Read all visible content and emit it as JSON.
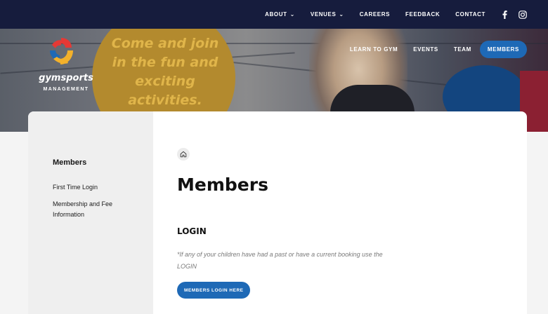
{
  "topnav": {
    "items": [
      {
        "label": "ABOUT",
        "has_dropdown": true
      },
      {
        "label": "VENUES",
        "has_dropdown": true
      },
      {
        "label": "CAREERS",
        "has_dropdown": false
      },
      {
        "label": "FEEDBACK",
        "has_dropdown": false
      },
      {
        "label": "CONTACT",
        "has_dropdown": false
      }
    ],
    "social": [
      "facebook-icon",
      "instagram-icon"
    ]
  },
  "logo": {
    "name": "gymsports",
    "sub": "MANAGEMENT"
  },
  "hero": {
    "slogan": "Come and join in the fun and exciting activities."
  },
  "mainnav": {
    "items": [
      {
        "label": "LEARN TO GYM"
      },
      {
        "label": "EVENTS"
      },
      {
        "label": "TEAM"
      },
      {
        "label": "MEMBERS",
        "active": true
      }
    ]
  },
  "sidebar": {
    "title": "Members",
    "links": [
      {
        "label": "First Time Login"
      },
      {
        "label": "Membership and Fee Information"
      }
    ]
  },
  "content": {
    "breadcrumb_icon": "home-icon",
    "title": "Members",
    "section_title": "LOGIN",
    "note": "*If any of your children have had a past or have a current booking use the LOGIN",
    "button_label": "MEMBERS LOGIN HERE"
  },
  "colors": {
    "topbar": "#161c3d",
    "accent_blue": "#1e69b6",
    "sidebar_bg": "#efefef",
    "slogan_circle": "#b38a2e",
    "slogan_text": "#e0b54a"
  }
}
